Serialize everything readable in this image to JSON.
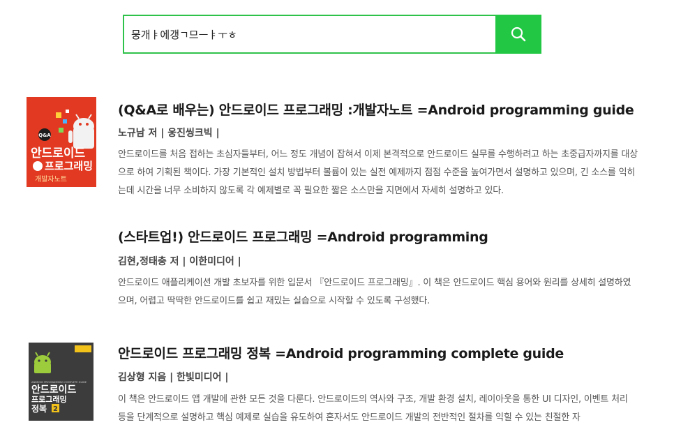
{
  "search": {
    "query": "뭉개ㅑ에갱ㄱ므ㅡㅑㅜㅎ",
    "button_icon": "search-icon",
    "accent": "#22c744"
  },
  "results": [
    {
      "title": "(Q&A로 배우는) 안드로이드 프로그래밍 :개발자노트 =Android programming guide",
      "meta": "노규남 저 | 웅진씽크빅 |",
      "description": "안드로이드를 처음 접하는 초심자들부터, 어느 정도 개념이 잡혀서 이제 본격적으로 안드로이드 실무를 수행하려고 하는 초중급자까지를 대상으로 하여 기획된 책이다. 가장 기본적인 설치 방법부터 볼륨이 있는 실전 예제까지 점점 수준을 높여가면서 설명하고 있으며, 긴 소스를 익히는데 시간을 너무 소비하지 않도록 각 예제별로 꼭 필요한 짧은 소스만을 지면에서 자세히 설명하고 있다.",
      "cover": {
        "badge": "Q&A로 배우는",
        "line1": "안드로이드",
        "line2": "프로그래밍",
        "line3": "개발자노트",
        "bg": "#e23a22"
      }
    },
    {
      "title": "(스타트업!) 안드로이드 프로그래밍 =Android programming",
      "meta": "김현,정태충 저 | 이한미디어 |",
      "description": "안드로이드 애플리케이션 개발 초보자를 위한 입문서 『안드로이드 프로그래밍』. 이 책은 안드로이드 핵심 용어와 원리를 상세히 설명하였으며, 어렵고 딱딱한 안드로이드를 쉽고 재밌는 실습으로 시작할 수 있도록 구성했다."
    },
    {
      "title": "안드로이드 프로그래밍 정복 =Android programming complete guide",
      "meta": "김상형 지음 | 한빛미디어 |",
      "description": "이 책은 안드로이드 앱 개발에 관한 모든 것을 다룬다. 안드로이드의 역사와 구조, 개발 환경 설치, 레이아웃을 통한 UI 디자인, 이벤트 처리 등을 단계적으로 설명하고 핵심 예제로 실습을 유도하여 혼자서도 안드로이드 개발의 전반적인 절차를 익힐 수 있는 친절한 자",
      "cover": {
        "top": "ANDROID PROGRAMMING COMPLETE GUIDE",
        "line1": "안드로이드",
        "line2": "프로그래밍",
        "line3": "정복",
        "volume": "2",
        "bg": "#3c3c3c"
      }
    }
  ]
}
